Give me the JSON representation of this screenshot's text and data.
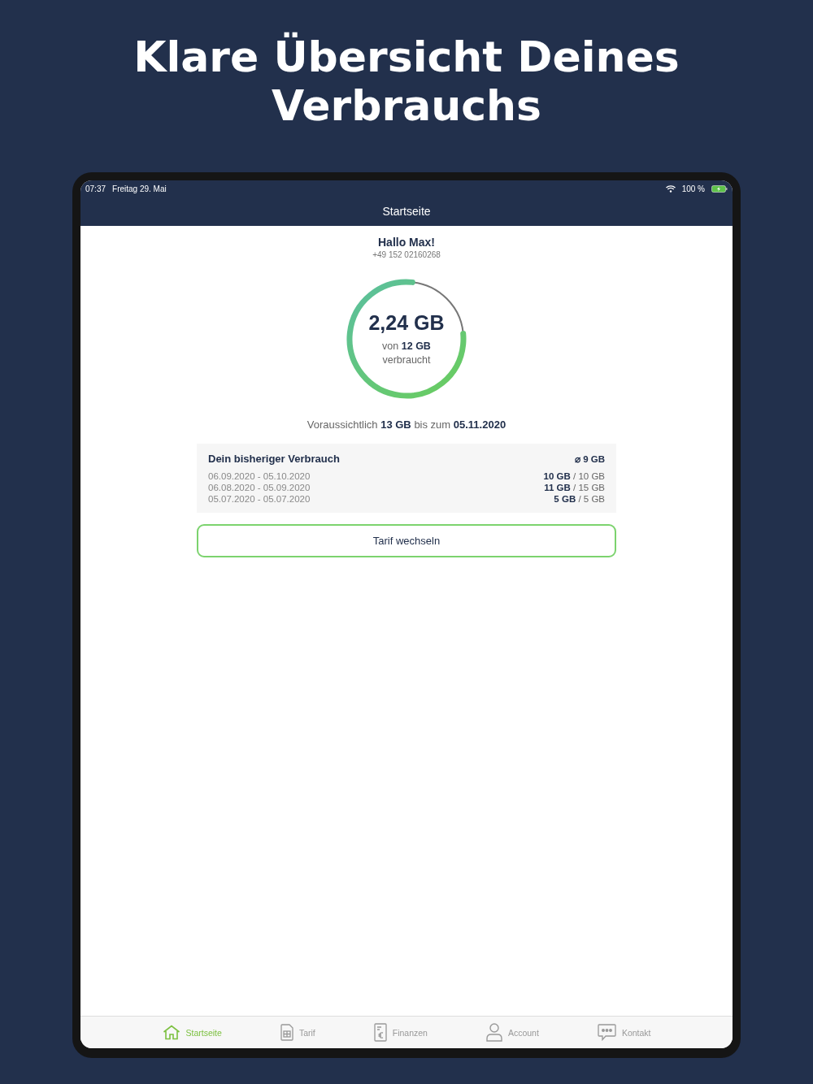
{
  "headline": "Klare Übersicht Deines Verbrauchs",
  "status_bar": {
    "time": "07:37",
    "date": "Freitag 29. Mai",
    "battery": "100 %"
  },
  "nav_bar": {
    "title": "Startseite"
  },
  "greeting": {
    "title": "Hallo Max!",
    "phone": "+49 152 02160268"
  },
  "gauge": {
    "value": "2,24 GB",
    "caption": "von **12 GB**",
    "caption_2": "verbraucht",
    "level": 0.78
  },
  "forecast": "Voraussichtlich **13 GB** bis zum **05.11.2020**",
  "history": {
    "title": "Dein bisheriger Verbrauch",
    "average": "⌀ 9 GB",
    "rows": [
      {
        "period": "06.09.2020 - 05.10.2020",
        "usage": "**10 GB** / 10 GB"
      },
      {
        "period": "06.08.2020 - 05.09.2020",
        "usage": "**11 GB** / 15 GB"
      },
      {
        "period": "05.07.2020 - 05.07.2020",
        "usage": "**5 GB** / 5 GB"
      }
    ]
  },
  "button": "Tarif wechseln",
  "tab_bar": [
    {
      "label": "Startseite",
      "kind": "home",
      "selected": true
    },
    {
      "label": "Tarif",
      "kind": "sim",
      "selected": false
    },
    {
      "label": "Finanzen",
      "kind": "invoice",
      "selected": false
    },
    {
      "label": "Account",
      "kind": "person",
      "selected": false
    },
    {
      "label": "Kontakt",
      "kind": "chat",
      "selected": false
    }
  ]
}
